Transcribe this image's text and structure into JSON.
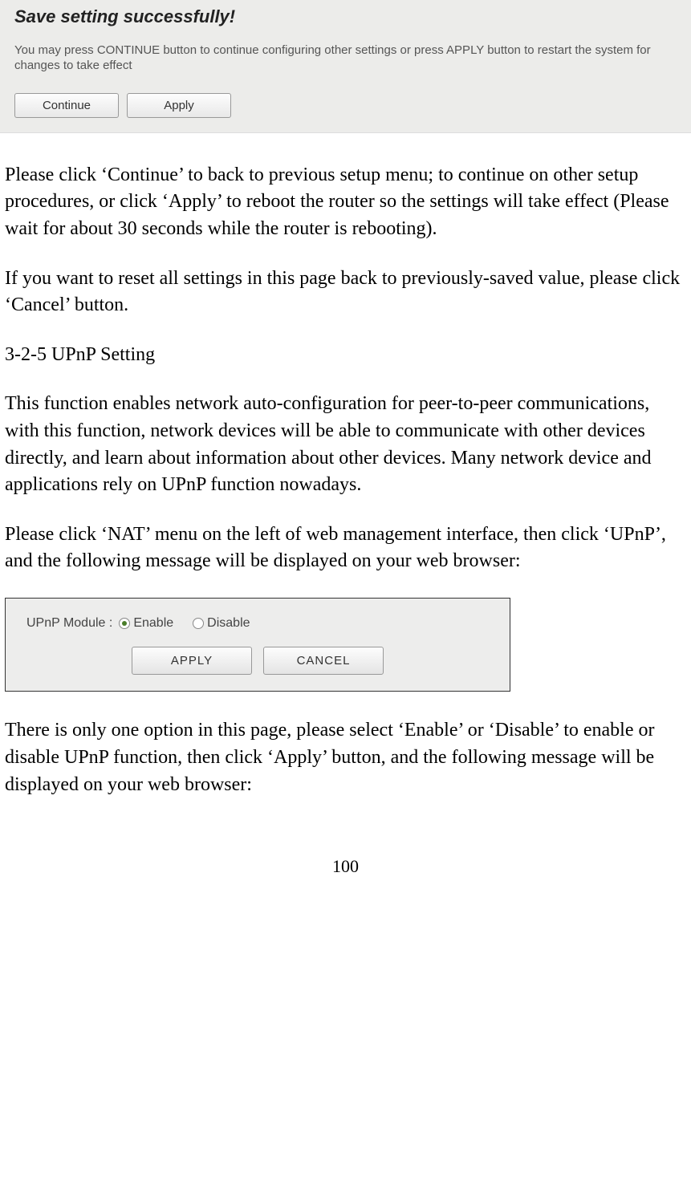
{
  "panel1": {
    "title": "Save setting successfully!",
    "text": "You may press CONTINUE button to continue configuring other settings or press APPLY button to restart the system for changes to take effect",
    "continue_label": "Continue",
    "apply_label": "Apply"
  },
  "body": {
    "para1": "Please click ‘Continue’ to back to previous setup menu; to continue on other setup procedures, or click ‘Apply’ to reboot the router so the settings will take effect (Please wait for about 30 seconds while the router is rebooting).",
    "para2": "If you want to reset all settings in this page back to previously-saved value, please click ‘Cancel’ button.",
    "heading": "3-2-5 UPnP Setting",
    "para3": "This function enables network auto-configuration for peer-to-peer communications, with this function, network devices will be able to communicate with other devices directly, and learn about information about other devices. Many network device and applications rely on UPnP function nowadays.",
    "para4": "Please click ‘NAT’ menu on the left of web management interface, then click ‘UPnP’, and the following message will be displayed on your web browser:",
    "para5": "There is only one option in this page, please select ‘Enable’ or ‘Disable’ to enable or disable UPnP function, then click ‘Apply’ button, and the following message will be displayed on your web browser:"
  },
  "panel2": {
    "label": "UPnP Module :",
    "enable_label": "Enable",
    "disable_label": "Disable",
    "apply_label": "APPLY",
    "cancel_label": "CANCEL"
  },
  "page_number": "100"
}
